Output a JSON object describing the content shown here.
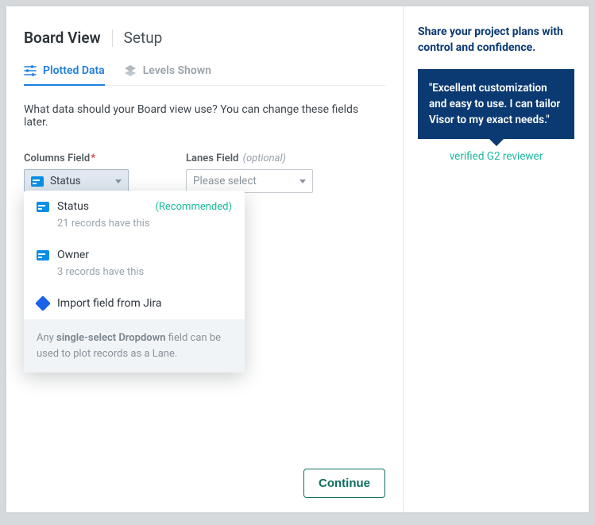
{
  "breadcrumb": {
    "title": "Board View",
    "sub": "Setup"
  },
  "tabs": [
    {
      "label": "Plotted Data",
      "active": true
    },
    {
      "label": "Levels Shown",
      "active": false
    }
  ],
  "helper_text": "What data should your Board view use? You can change these fields later.",
  "columns_field": {
    "label": "Columns Field",
    "required": true,
    "selected": "Status"
  },
  "lanes_field": {
    "label": "Lanes Field",
    "optional_text": "(optional)",
    "placeholder": "Please select"
  },
  "dropdown": {
    "options": [
      {
        "name": "Status",
        "recommended": "(Recommended)",
        "meta": "21 records have this"
      },
      {
        "name": "Owner",
        "meta": "3 records have this"
      }
    ],
    "import_label": "Import field from Jira",
    "footer_pre": "Any ",
    "footer_bold": "single-select Dropdown",
    "footer_post": " field can be used to plot records as a Lane."
  },
  "continue_label": "Continue",
  "sidebar": {
    "heading": "Share your project plans with control and confidence.",
    "quote": "\"Excellent customization and easy to use. I can tailor Visor to my exact needs.\"",
    "reviewer": "verified G2 reviewer"
  }
}
